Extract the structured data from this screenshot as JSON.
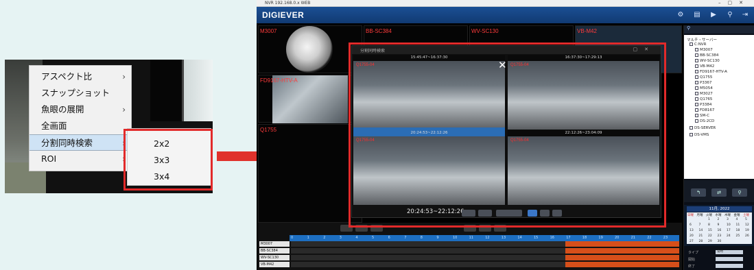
{
  "context_menu": {
    "items": [
      {
        "label": "アスペクト比",
        "has_submenu": true
      },
      {
        "label": "スナップショット",
        "has_submenu": false
      },
      {
        "label": "魚眼の展開",
        "has_submenu": true
      },
      {
        "label": "全画面",
        "has_submenu": false
      },
      {
        "label": "分割同時検索",
        "has_submenu": true,
        "selected": true
      },
      {
        "label": "ROI",
        "has_submenu": true
      }
    ],
    "submenu": [
      "2x2",
      "3x3",
      "3x4"
    ],
    "submenu_arrow": "›"
  },
  "app": {
    "title": "DIGIEVER",
    "window_title": "NVR 192.168.0.x WEB",
    "camera_labels": [
      "M3007",
      "BB-SC384",
      "WV-SC130",
      "VB-M42",
      "FD9167-HTV-A",
      "Q1755"
    ],
    "popup": {
      "title": "分割同時検索",
      "time_range": "20:24:53~22:12:26",
      "close_glyph": "✕",
      "cell_times": [
        "15:45:47~16:37:30",
        "16:37:30~17:29:13",
        "20:24:53~22:12:26",
        "22:12:26~23:04:09"
      ],
      "cell_labels": [
        "Q1755-04",
        "Q1755-04",
        "Q1755-04",
        "Q1755-04"
      ]
    },
    "sidebar": {
      "header": "マルチ・サーバー",
      "tree": [
        "C:NVR",
        "M3007",
        "BB-SC384",
        "WV-SC130",
        "VB-M42",
        "FD9167-HTV-A",
        "Q1755",
        "P3367",
        "M5054",
        "M3027",
        "Q1765",
        "P3384",
        "FD8167",
        "SM-C",
        "DS-2CD",
        "DS-SERVER",
        "DS-VMS"
      ],
      "calendar_title": "11月, 2022",
      "weekdays": [
        "日曜",
        "月曜",
        "火曜",
        "水曜",
        "木曜",
        "金曜",
        "土曜"
      ],
      "days": [
        "",
        "",
        "1",
        "2",
        "3",
        "4",
        "5",
        "6",
        "7",
        "8",
        "9",
        "10",
        "11",
        "12",
        "13",
        "14",
        "15",
        "16",
        "17",
        "18",
        "19",
        "20",
        "21",
        "22",
        "23",
        "24",
        "25",
        "26",
        "27",
        "28",
        "29",
        "30",
        "",
        "",
        ""
      ],
      "type_label": "タイプ",
      "type_value": "常時",
      "start_label": "開始",
      "end_label": "終了"
    },
    "timeline": {
      "hours": [
        "0",
        "1",
        "2",
        "3",
        "4",
        "5",
        "6",
        "7",
        "8",
        "9",
        "10",
        "11",
        "12",
        "13",
        "14",
        "15",
        "16",
        "17",
        "18",
        "19",
        "20",
        "21",
        "22",
        "23"
      ],
      "rows": [
        "M3007",
        "BB-SC384",
        "WV-SC130",
        "VB-M42"
      ]
    }
  },
  "colors": {
    "highlight_frame": "#e22a2a",
    "header_blue": "#1b4f94",
    "menu_selected": "#cfe3f5"
  }
}
